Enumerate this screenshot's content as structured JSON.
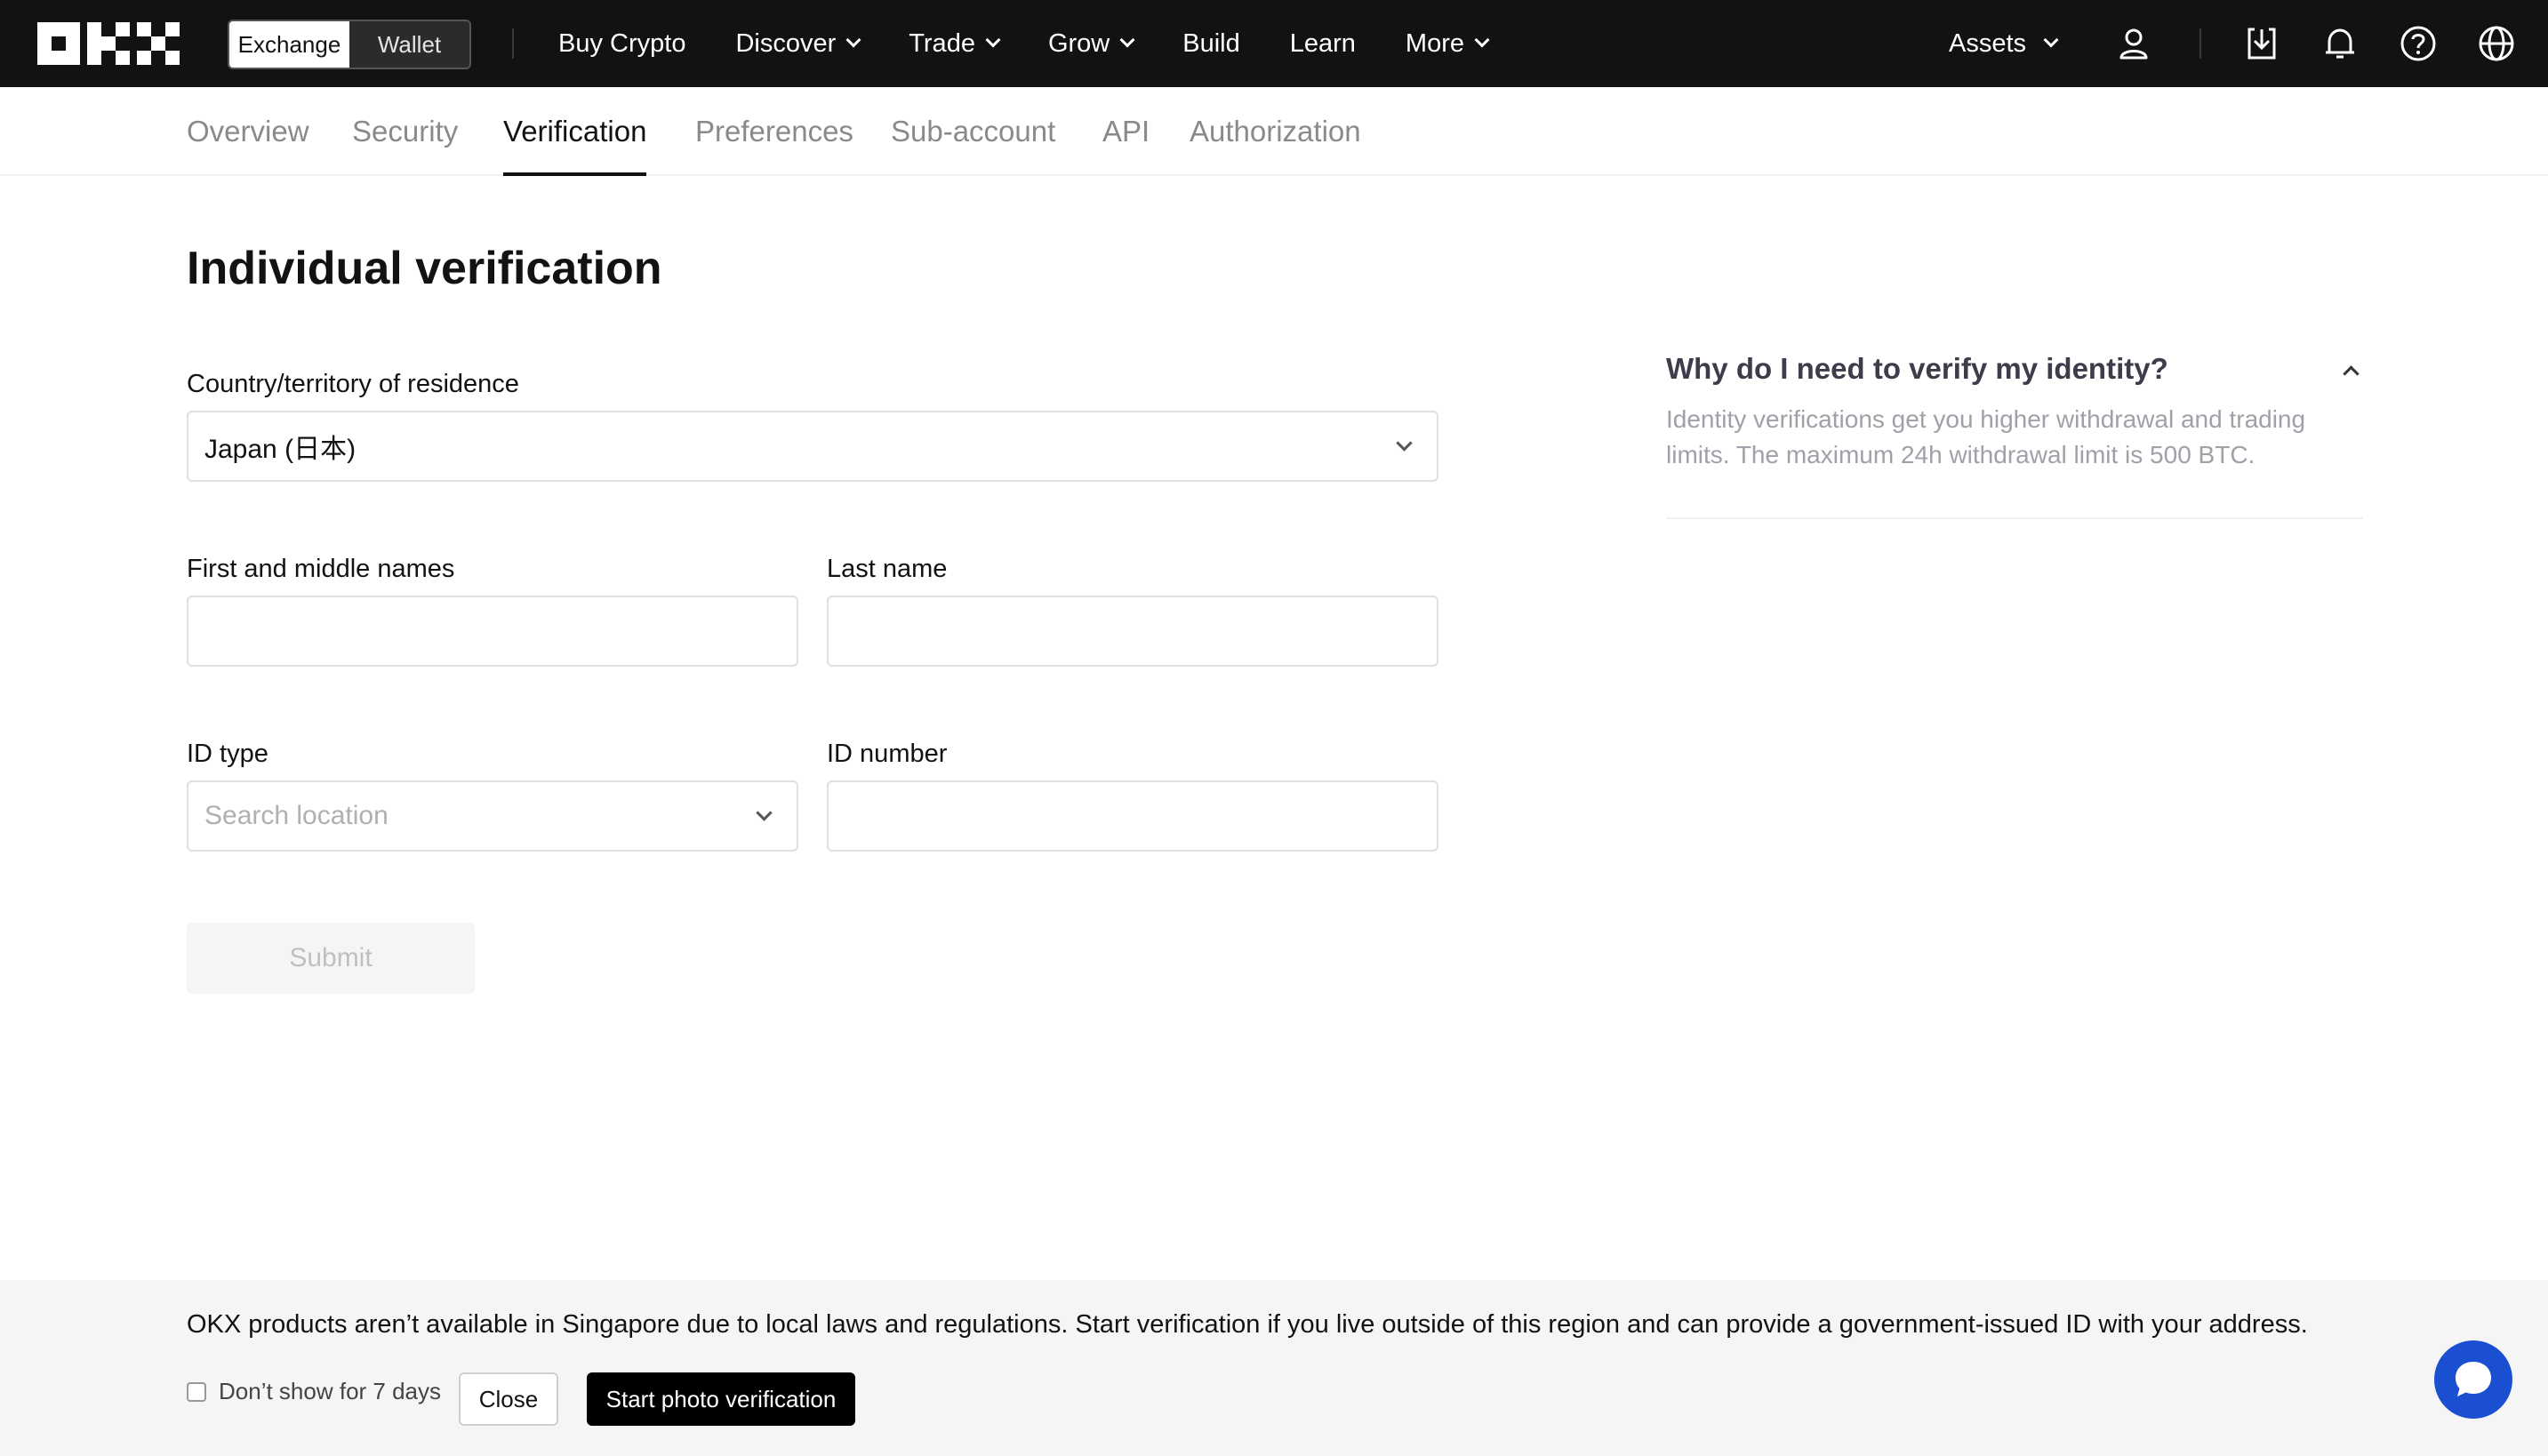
{
  "topbar": {
    "logo_icon": "okx-logo",
    "switcher": {
      "exchange": "Exchange",
      "wallet": "Wallet",
      "active": "Exchange"
    },
    "nav": [
      {
        "label": "Buy Crypto",
        "dropdown": false
      },
      {
        "label": "Discover",
        "dropdown": true
      },
      {
        "label": "Trade",
        "dropdown": true
      },
      {
        "label": "Grow",
        "dropdown": true
      },
      {
        "label": "Build",
        "dropdown": false
      },
      {
        "label": "Learn",
        "dropdown": false
      },
      {
        "label": "More",
        "dropdown": true
      }
    ],
    "assets": "Assets",
    "icons": [
      "user-icon",
      "download-icon",
      "bell-icon",
      "help-icon",
      "globe-icon"
    ]
  },
  "subnav": {
    "tabs": [
      "Overview",
      "Security",
      "Verification",
      "Preferences",
      "Sub-account",
      "API",
      "Authorization"
    ],
    "active": "Verification"
  },
  "form": {
    "title": "Individual verification",
    "country_label": "Country/territory of residence",
    "country_value": "Japan (日本)",
    "first_name_label": "First and middle names",
    "first_name_value": "",
    "last_name_label": "Last name",
    "last_name_value": "",
    "id_type_label": "ID type",
    "id_type_placeholder": "Search location",
    "id_number_label": "ID number",
    "id_number_value": "",
    "submit": "Submit"
  },
  "faq": {
    "title": "Why do I need to verify my identity?",
    "text": "Identity verifications get you higher withdrawal and trading limits. The maximum 24h withdrawal limit is 500 BTC."
  },
  "notice": {
    "text": "OKX products aren’t available in Singapore due to local laws and regulations. Start verification if you live outside of this region and can provide a government-issued ID with your address.",
    "dont_show": "Don’t show for 7 days",
    "close": "Close",
    "start": "Start photo verification"
  },
  "colors": {
    "topbar_bg": "#121212",
    "chat_button": "#1a4fd1"
  }
}
